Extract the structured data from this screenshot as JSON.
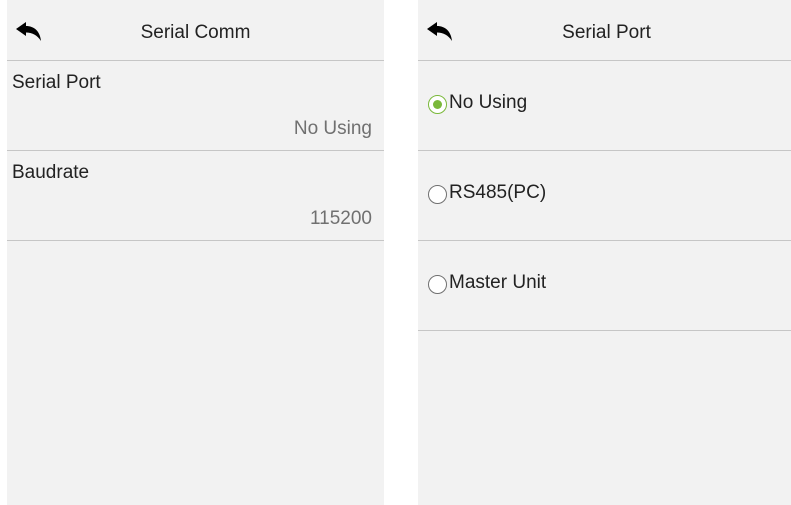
{
  "serial_comm": {
    "title": "Serial Comm",
    "settings": [
      {
        "label": "Serial Port",
        "value": "No Using"
      },
      {
        "label": "Baudrate",
        "value": "115200"
      }
    ]
  },
  "serial_port": {
    "title": "Serial Port",
    "options": [
      {
        "label": "No Using",
        "selected": true
      },
      {
        "label": "RS485(PC)",
        "selected": false
      },
      {
        "label": "Master Unit",
        "selected": false
      }
    ]
  },
  "icons": {
    "back": "back-arrow-icon"
  },
  "colors": {
    "accent": "#7ab83a",
    "background": "#f2f2f2",
    "divider": "#c6c6c6"
  }
}
